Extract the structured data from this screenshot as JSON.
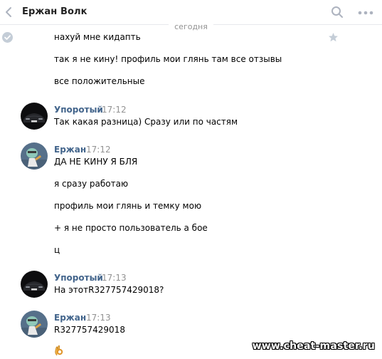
{
  "header": {
    "title": "Ержан Волк",
    "back_icon": "chevron-left-icon",
    "search_icon": "search-icon",
    "more_icon": "more-dots-icon"
  },
  "date_divider": "сегодня",
  "messages": [
    {
      "text": "нахуй мне кидапть"
    },
    {
      "text": "так я не кину! профиль мои глянь там все отзывы"
    },
    {
      "text": "все положительные"
    }
  ],
  "groups": [
    {
      "author": "Упоротый",
      "time": "17:12",
      "avatar": "car-avatar",
      "messages": [
        "Так какая разница) Сразу или по частям"
      ]
    },
    {
      "author": "Ержан",
      "time": "17:12",
      "avatar": "cartoon-avatar",
      "messages": [
        "ДА НЕ КИНУ Я БЛЯ",
        "я сразу работаю",
        "профиль мои глянь и темку мою",
        "+ я не просто пользователь а бое",
        "ц"
      ]
    },
    {
      "author": "Упоротый",
      "time": "17:13",
      "avatar": "car-avatar",
      "messages": [
        "На этотR327757429018?"
      ]
    },
    {
      "author": "Ержан",
      "time": "17:13",
      "avatar": "cartoon-avatar",
      "messages": [
        "R327757429018"
      ]
    }
  ],
  "watermark": "www.cheat-master.ru",
  "colors": {
    "author_link": "#42648b",
    "time": "#939393",
    "divider": "#e7e8ec",
    "icon_gray": "#adb3bf"
  }
}
